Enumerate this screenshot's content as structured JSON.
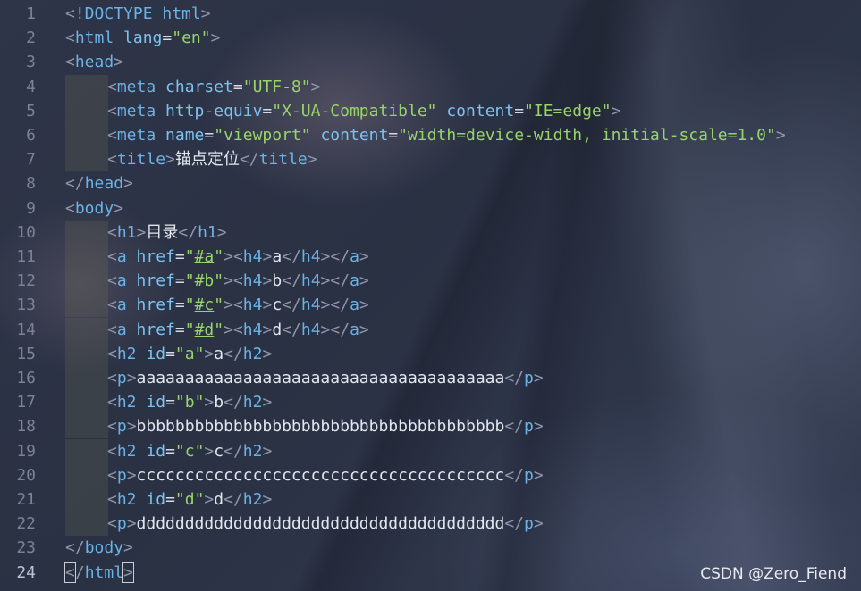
{
  "editor": {
    "lines": [
      {
        "n": "1",
        "indent": 0,
        "tokens": [
          [
            "bracket",
            "<"
          ],
          [
            "doctype",
            "!DOCTYPE html"
          ],
          [
            "bracket",
            ">"
          ]
        ]
      },
      {
        "n": "2",
        "indent": 0,
        "tokens": [
          [
            "bracket",
            "<"
          ],
          [
            "tag",
            "html"
          ],
          [
            "text",
            " "
          ],
          [
            "attr",
            "lang"
          ],
          [
            "eq",
            "="
          ],
          [
            "str",
            "\"en\""
          ],
          [
            "bracket",
            ">"
          ]
        ]
      },
      {
        "n": "3",
        "indent": 0,
        "tokens": [
          [
            "bracket",
            "<"
          ],
          [
            "tag",
            "head"
          ],
          [
            "bracket",
            ">"
          ]
        ]
      },
      {
        "n": "4",
        "indent": 1,
        "tokens": [
          [
            "bracket",
            "<"
          ],
          [
            "tag",
            "meta"
          ],
          [
            "text",
            " "
          ],
          [
            "attr",
            "charset"
          ],
          [
            "eq",
            "="
          ],
          [
            "str",
            "\"UTF-8\""
          ],
          [
            "bracket",
            ">"
          ]
        ]
      },
      {
        "n": "5",
        "indent": 1,
        "tokens": [
          [
            "bracket",
            "<"
          ],
          [
            "tag",
            "meta"
          ],
          [
            "text",
            " "
          ],
          [
            "attr",
            "http-equiv"
          ],
          [
            "eq",
            "="
          ],
          [
            "str",
            "\"X-UA-Compatible\""
          ],
          [
            "text",
            " "
          ],
          [
            "attr",
            "content"
          ],
          [
            "eq",
            "="
          ],
          [
            "str",
            "\"IE=edge\""
          ],
          [
            "bracket",
            ">"
          ]
        ]
      },
      {
        "n": "6",
        "indent": 1,
        "tokens": [
          [
            "bracket",
            "<"
          ],
          [
            "tag",
            "meta"
          ],
          [
            "text",
            " "
          ],
          [
            "attr",
            "name"
          ],
          [
            "eq",
            "="
          ],
          [
            "str",
            "\"viewport\""
          ],
          [
            "text",
            " "
          ],
          [
            "attr",
            "content"
          ],
          [
            "eq",
            "="
          ],
          [
            "str",
            "\"width=device-width, initial-scale=1.0\""
          ],
          [
            "bracket",
            ">"
          ]
        ]
      },
      {
        "n": "7",
        "indent": 1,
        "tokens": [
          [
            "bracket",
            "<"
          ],
          [
            "tag",
            "title"
          ],
          [
            "bracket",
            ">"
          ],
          [
            "text",
            "锚点定位"
          ],
          [
            "bracket",
            "</"
          ],
          [
            "tag",
            "title"
          ],
          [
            "bracket",
            ">"
          ]
        ]
      },
      {
        "n": "8",
        "indent": 0,
        "tokens": [
          [
            "bracket",
            "</"
          ],
          [
            "tag",
            "head"
          ],
          [
            "bracket",
            ">"
          ]
        ]
      },
      {
        "n": "9",
        "indent": 0,
        "tokens": [
          [
            "bracket",
            "<"
          ],
          [
            "tag",
            "body"
          ],
          [
            "bracket",
            ">"
          ]
        ]
      },
      {
        "n": "10",
        "indent": 1,
        "tokens": [
          [
            "bracket",
            "<"
          ],
          [
            "tag",
            "h1"
          ],
          [
            "bracket",
            ">"
          ],
          [
            "text",
            "目录"
          ],
          [
            "bracket",
            "</"
          ],
          [
            "tag",
            "h1"
          ],
          [
            "bracket",
            ">"
          ]
        ]
      },
      {
        "n": "11",
        "indent": 1,
        "tokens": [
          [
            "bracket",
            "<"
          ],
          [
            "tag",
            "a"
          ],
          [
            "text",
            " "
          ],
          [
            "attr",
            "href"
          ],
          [
            "eq",
            "="
          ],
          [
            "str",
            "\""
          ],
          [
            "link",
            "#a"
          ],
          [
            "str",
            "\""
          ],
          [
            "bracket",
            ">"
          ],
          [
            "bracket",
            "<"
          ],
          [
            "tag",
            "h4"
          ],
          [
            "bracket",
            ">"
          ],
          [
            "text",
            "a"
          ],
          [
            "bracket",
            "</"
          ],
          [
            "tag",
            "h4"
          ],
          [
            "bracket",
            ">"
          ],
          [
            "bracket",
            "</"
          ],
          [
            "tag",
            "a"
          ],
          [
            "bracket",
            ">"
          ]
        ]
      },
      {
        "n": "12",
        "indent": 1,
        "tokens": [
          [
            "bracket",
            "<"
          ],
          [
            "tag",
            "a"
          ],
          [
            "text",
            " "
          ],
          [
            "attr",
            "href"
          ],
          [
            "eq",
            "="
          ],
          [
            "str",
            "\""
          ],
          [
            "link",
            "#b"
          ],
          [
            "str",
            "\""
          ],
          [
            "bracket",
            ">"
          ],
          [
            "bracket",
            "<"
          ],
          [
            "tag",
            "h4"
          ],
          [
            "bracket",
            ">"
          ],
          [
            "text",
            "b"
          ],
          [
            "bracket",
            "</"
          ],
          [
            "tag",
            "h4"
          ],
          [
            "bracket",
            ">"
          ],
          [
            "bracket",
            "</"
          ],
          [
            "tag",
            "a"
          ],
          [
            "bracket",
            ">"
          ]
        ]
      },
      {
        "n": "13",
        "indent": 1,
        "tokens": [
          [
            "bracket",
            "<"
          ],
          [
            "tag",
            "a"
          ],
          [
            "text",
            " "
          ],
          [
            "attr",
            "href"
          ],
          [
            "eq",
            "="
          ],
          [
            "str",
            "\""
          ],
          [
            "link",
            "#c"
          ],
          [
            "str",
            "\""
          ],
          [
            "bracket",
            ">"
          ],
          [
            "bracket",
            "<"
          ],
          [
            "tag",
            "h4"
          ],
          [
            "bracket",
            ">"
          ],
          [
            "text",
            "c"
          ],
          [
            "bracket",
            "</"
          ],
          [
            "tag",
            "h4"
          ],
          [
            "bracket",
            ">"
          ],
          [
            "bracket",
            "</"
          ],
          [
            "tag",
            "a"
          ],
          [
            "bracket",
            ">"
          ]
        ]
      },
      {
        "n": "14",
        "indent": 1,
        "tokens": [
          [
            "bracket",
            "<"
          ],
          [
            "tag",
            "a"
          ],
          [
            "text",
            " "
          ],
          [
            "attr",
            "href"
          ],
          [
            "eq",
            "="
          ],
          [
            "str",
            "\""
          ],
          [
            "link",
            "#d"
          ],
          [
            "str",
            "\""
          ],
          [
            "bracket",
            ">"
          ],
          [
            "bracket",
            "<"
          ],
          [
            "tag",
            "h4"
          ],
          [
            "bracket",
            ">"
          ],
          [
            "text",
            "d"
          ],
          [
            "bracket",
            "</"
          ],
          [
            "tag",
            "h4"
          ],
          [
            "bracket",
            ">"
          ],
          [
            "bracket",
            "</"
          ],
          [
            "tag",
            "a"
          ],
          [
            "bracket",
            ">"
          ]
        ]
      },
      {
        "n": "15",
        "indent": 1,
        "tokens": [
          [
            "bracket",
            "<"
          ],
          [
            "tag",
            "h2"
          ],
          [
            "text",
            " "
          ],
          [
            "attr",
            "id"
          ],
          [
            "eq",
            "="
          ],
          [
            "str",
            "\"a\""
          ],
          [
            "bracket",
            ">"
          ],
          [
            "text",
            "a"
          ],
          [
            "bracket",
            "</"
          ],
          [
            "tag",
            "h2"
          ],
          [
            "bracket",
            ">"
          ]
        ]
      },
      {
        "n": "16",
        "indent": 1,
        "tokens": [
          [
            "bracket",
            "<"
          ],
          [
            "tag",
            "p"
          ],
          [
            "bracket",
            ">"
          ],
          [
            "text",
            "aaaaaaaaaaaaaaaaaaaaaaaaaaaaaaaaaaaaaa"
          ],
          [
            "bracket",
            "</"
          ],
          [
            "tag",
            "p"
          ],
          [
            "bracket",
            ">"
          ]
        ]
      },
      {
        "n": "17",
        "indent": 1,
        "tokens": [
          [
            "bracket",
            "<"
          ],
          [
            "tag",
            "h2"
          ],
          [
            "text",
            " "
          ],
          [
            "attr",
            "id"
          ],
          [
            "eq",
            "="
          ],
          [
            "str",
            "\"b\""
          ],
          [
            "bracket",
            ">"
          ],
          [
            "text",
            "b"
          ],
          [
            "bracket",
            "</"
          ],
          [
            "tag",
            "h2"
          ],
          [
            "bracket",
            ">"
          ]
        ]
      },
      {
        "n": "18",
        "indent": 1,
        "tokens": [
          [
            "bracket",
            "<"
          ],
          [
            "tag",
            "p"
          ],
          [
            "bracket",
            ">"
          ],
          [
            "text",
            "bbbbbbbbbbbbbbbbbbbbbbbbbbbbbbbbbbbbbb"
          ],
          [
            "bracket",
            "</"
          ],
          [
            "tag",
            "p"
          ],
          [
            "bracket",
            ">"
          ]
        ]
      },
      {
        "n": "19",
        "indent": 1,
        "tokens": [
          [
            "bracket",
            "<"
          ],
          [
            "tag",
            "h2"
          ],
          [
            "text",
            " "
          ],
          [
            "attr",
            "id"
          ],
          [
            "eq",
            "="
          ],
          [
            "str",
            "\"c\""
          ],
          [
            "bracket",
            ">"
          ],
          [
            "text",
            "c"
          ],
          [
            "bracket",
            "</"
          ],
          [
            "tag",
            "h2"
          ],
          [
            "bracket",
            ">"
          ]
        ]
      },
      {
        "n": "20",
        "indent": 1,
        "tokens": [
          [
            "bracket",
            "<"
          ],
          [
            "tag",
            "p"
          ],
          [
            "bracket",
            ">"
          ],
          [
            "text",
            "cccccccccccccccccccccccccccccccccccccc"
          ],
          [
            "bracket",
            "</"
          ],
          [
            "tag",
            "p"
          ],
          [
            "bracket",
            ">"
          ]
        ]
      },
      {
        "n": "21",
        "indent": 1,
        "tokens": [
          [
            "bracket",
            "<"
          ],
          [
            "tag",
            "h2"
          ],
          [
            "text",
            " "
          ],
          [
            "attr",
            "id"
          ],
          [
            "eq",
            "="
          ],
          [
            "str",
            "\"d\""
          ],
          [
            "bracket",
            ">"
          ],
          [
            "text",
            "d"
          ],
          [
            "bracket",
            "</"
          ],
          [
            "tag",
            "h2"
          ],
          [
            "bracket",
            ">"
          ]
        ]
      },
      {
        "n": "22",
        "indent": 1,
        "tokens": [
          [
            "bracket",
            "<"
          ],
          [
            "tag",
            "p"
          ],
          [
            "bracket",
            ">"
          ],
          [
            "text",
            "dddddddddddddddddddddddddddddddddddddd"
          ],
          [
            "bracket",
            "</"
          ],
          [
            "tag",
            "p"
          ],
          [
            "bracket",
            ">"
          ]
        ]
      },
      {
        "n": "23",
        "indent": 0,
        "tokens": [
          [
            "bracket",
            "</"
          ],
          [
            "tag",
            "body"
          ],
          [
            "bracket",
            ">"
          ]
        ]
      },
      {
        "n": "24",
        "indent": 0,
        "active": true,
        "tokens": [
          [
            "cursorbracket",
            "<"
          ],
          [
            "bracket",
            "/"
          ],
          [
            "tag",
            "html"
          ],
          [
            "cursorbracket",
            ">"
          ]
        ]
      }
    ]
  },
  "watermark": "CSDN @Zero_Fiend"
}
